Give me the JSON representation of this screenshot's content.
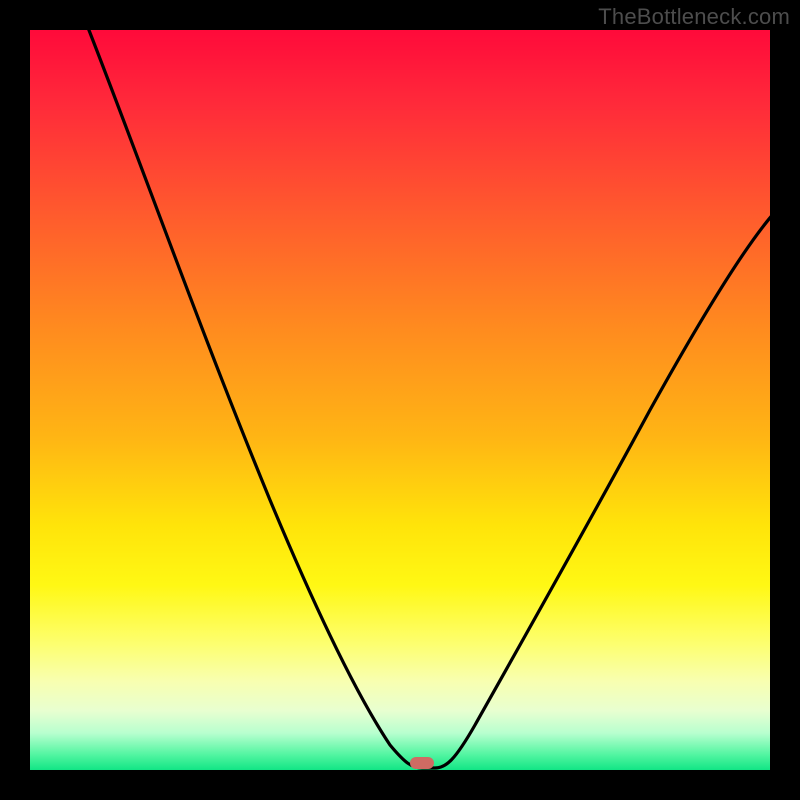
{
  "watermark": "TheBottleneck.com",
  "colors": {
    "frame": "#000000",
    "curve": "#000000",
    "marker": "#cf6b63",
    "gradient_top": "#ff0a3a",
    "gradient_bottom": "#12e585"
  },
  "chart_data": {
    "type": "line",
    "title": "",
    "xlabel": "",
    "ylabel": "",
    "xlim": [
      0,
      100
    ],
    "ylim": [
      0,
      100
    ],
    "series": [
      {
        "name": "bottleneck-curve",
        "x": [
          0,
          5,
          10,
          15,
          20,
          25,
          30,
          35,
          40,
          45,
          48,
          50,
          52,
          54,
          56,
          60,
          65,
          70,
          75,
          80,
          85,
          90,
          95,
          100
        ],
        "values": [
          100,
          92,
          84,
          76,
          68,
          59,
          50,
          41,
          31,
          18,
          8,
          2,
          0,
          0,
          2,
          8,
          18,
          29,
          39,
          48,
          56,
          63,
          69,
          74
        ]
      }
    ],
    "optimum_x": 53,
    "optimum_y": 1
  }
}
